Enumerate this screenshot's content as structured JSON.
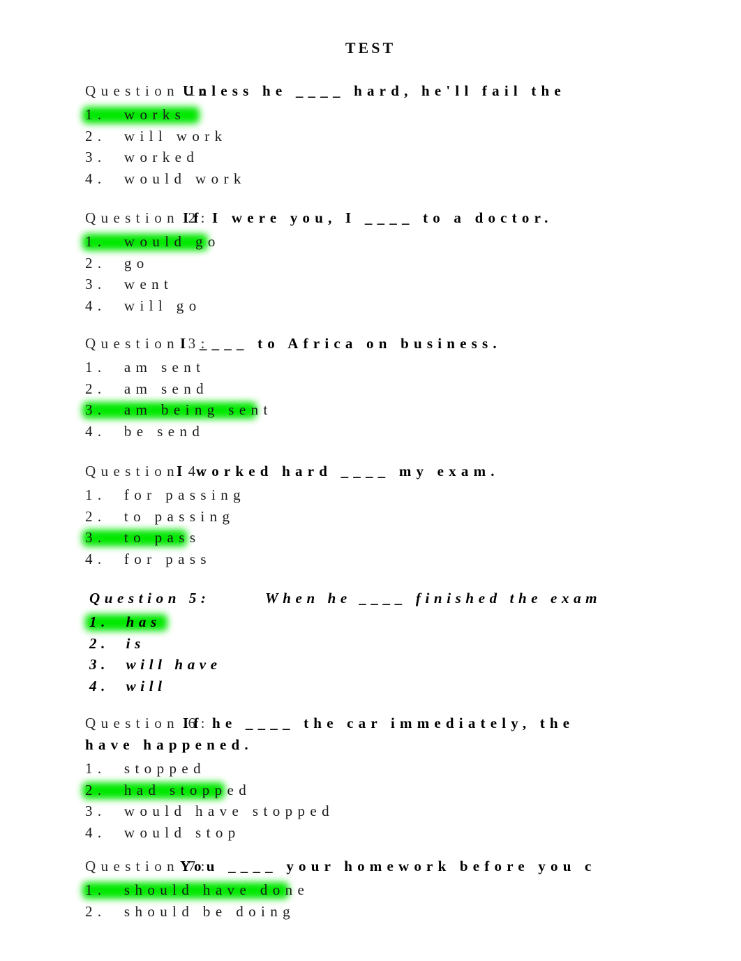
{
  "document": {
    "title": "TEST",
    "highlight_color": "#00e800",
    "text_color": "#000000"
  },
  "questions": [
    {
      "label": "Question 1:",
      "text_lines": [
        "Unless he ____ hard, he'll fail the"
      ],
      "style": "normal",
      "options": [
        {
          "num": "1.",
          "text": "works",
          "highlighted": true
        },
        {
          "num": "2.",
          "text": "will work",
          "highlighted": false
        },
        {
          "num": "3.",
          "text": "worked",
          "highlighted": false
        },
        {
          "num": "4.",
          "text": "would work",
          "highlighted": false
        }
      ]
    },
    {
      "label": "Question 2:",
      "text_lines": [
        "If I were you, I ____ to a doctor."
      ],
      "style": "normal",
      "options": [
        {
          "num": "1.",
          "text": "would go",
          "highlighted": true
        },
        {
          "num": "2.",
          "text": "go",
          "highlighted": false
        },
        {
          "num": "3.",
          "text": "went",
          "highlighted": false
        },
        {
          "num": "4.",
          "text": "will go",
          "highlighted": false
        }
      ]
    },
    {
      "label": "Question 3:",
      "text_lines": [
        "I ____ to Africa on business."
      ],
      "style": "normal",
      "options": [
        {
          "num": "1.",
          "text": "am sent",
          "highlighted": false
        },
        {
          "num": "2.",
          "text": "am send",
          "highlighted": false
        },
        {
          "num": "3.",
          "text": "am being sent",
          "highlighted": true
        },
        {
          "num": "4.",
          "text": "be send",
          "highlighted": false
        }
      ]
    },
    {
      "label": "Question 4:",
      "text_lines": [
        "I worked hard ____ my exam."
      ],
      "style": "normal",
      "options": [
        {
          "num": "1.",
          "text": "for passing",
          "highlighted": false
        },
        {
          "num": "2.",
          "text": "to passing",
          "highlighted": false
        },
        {
          "num": "3.",
          "text": "to pass",
          "highlighted": true
        },
        {
          "num": "4.",
          "text": "for pass",
          "highlighted": false
        }
      ]
    },
    {
      "label": "Question 5:",
      "text_lines": [
        "When he ____ finished the exam"
      ],
      "style": "bold-italic",
      "options": [
        {
          "num": "1.",
          "text": "has",
          "highlighted": true
        },
        {
          "num": "2.",
          "text": "is",
          "highlighted": false
        },
        {
          "num": "3.",
          "text": "will have",
          "highlighted": false
        },
        {
          "num": "4.",
          "text": "will",
          "highlighted": false
        }
      ]
    },
    {
      "label": "Question 6:",
      "text_lines": [
        "If he ____ the car immediately, the",
        "have happened."
      ],
      "style": "normal",
      "options": [
        {
          "num": "1.",
          "text": "stopped",
          "highlighted": false
        },
        {
          "num": "2.",
          "text": "had stopped",
          "highlighted": true
        },
        {
          "num": "3.",
          "text": "would have stopped",
          "highlighted": false
        },
        {
          "num": "4.",
          "text": "would stop",
          "highlighted": false
        }
      ]
    },
    {
      "label": "Question 7:",
      "text_lines": [
        "You ____ your homework before you c"
      ],
      "style": "normal",
      "options": [
        {
          "num": "1.",
          "text": "should have done",
          "highlighted": true
        },
        {
          "num": "2.",
          "text": "should be doing",
          "highlighted": false
        }
      ]
    }
  ]
}
